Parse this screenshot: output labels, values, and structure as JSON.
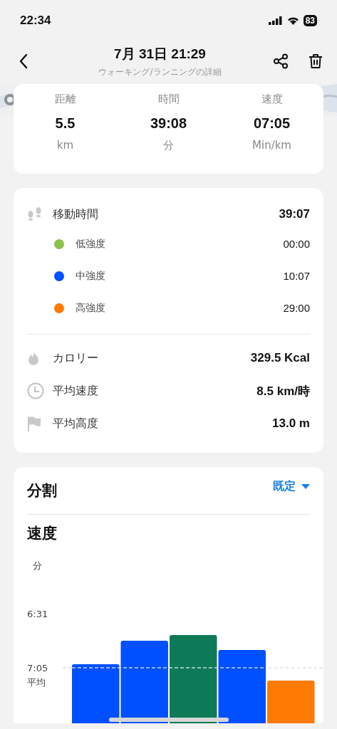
{
  "status_bar": {
    "time": "22:34",
    "battery": "83"
  },
  "header": {
    "title": "7月 31日 21:29",
    "subtitle": "ウォーキング/ランニングの詳細"
  },
  "summary": [
    {
      "label": "距離",
      "value": "5.5",
      "unit": "km"
    },
    {
      "label": "時間",
      "value": "39:08",
      "unit": "分"
    },
    {
      "label": "速度",
      "value": "07:05",
      "unit": "Min/km"
    }
  ],
  "moving_time": {
    "label": "移動時間",
    "value": "39:07",
    "zones": [
      {
        "label": "低強度",
        "value": "00:00",
        "color": "#8bc34a"
      },
      {
        "label": "中強度",
        "value": "10:07",
        "color": "#0050ff"
      },
      {
        "label": "高強度",
        "value": "29:00",
        "color": "#ff7a00"
      }
    ]
  },
  "metrics": [
    {
      "kind": "flame",
      "label": "カロリー",
      "value": "329.5 Kcal"
    },
    {
      "kind": "clock",
      "label": "平均速度",
      "value": "8.5 km/時"
    },
    {
      "kind": "flag",
      "label": "平均高度",
      "value": "13.0 m"
    }
  ],
  "splits": {
    "title": "分割",
    "dropdown": "既定",
    "chart_title": "速度",
    "average_label": "平均",
    "y_unit": "分",
    "y_ticks": [
      "6:31",
      "7:05"
    ],
    "bars": [
      {
        "color": "#0050ff"
      },
      {
        "color": "#0050ff"
      },
      {
        "color": "#0f7a57"
      },
      {
        "color": "#0050ff"
      },
      {
        "color": "#ff7a00"
      }
    ]
  }
}
